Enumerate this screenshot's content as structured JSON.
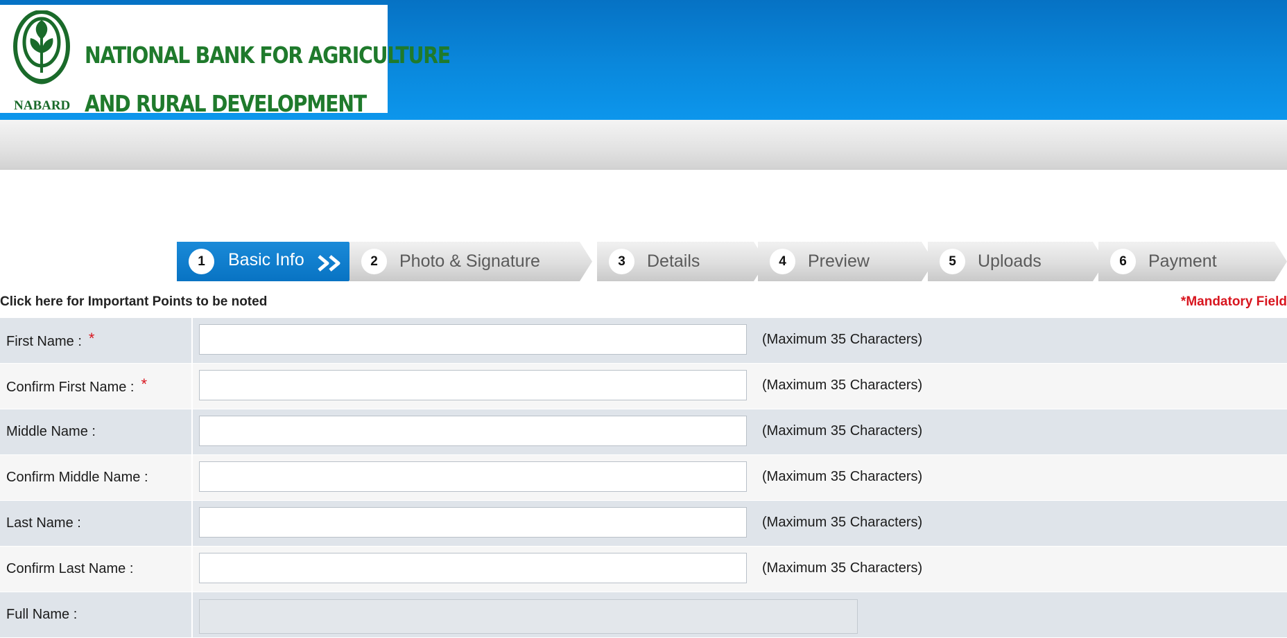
{
  "header": {
    "org_abbr": "NABARD",
    "org_name_line1": "NATIONAL BANK FOR AGRICULTURE",
    "org_name_line2": "AND RURAL DEVELOPMENT",
    "colors": {
      "header_blue": "#0a88dc",
      "logo_green": "#1f7a2c"
    }
  },
  "steps": [
    {
      "num": "1",
      "label": "Basic Info",
      "active": true
    },
    {
      "num": "2",
      "label": "Photo & Signature",
      "active": false
    },
    {
      "num": "3",
      "label": "Details",
      "active": false
    },
    {
      "num": "4",
      "label": "Preview",
      "active": false
    },
    {
      "num": "5",
      "label": "Uploads",
      "active": false
    },
    {
      "num": "6",
      "label": "Payment",
      "active": false
    }
  ],
  "important_link": "Click here for Important Points to be noted",
  "mandatory_note": "*Mandatory Field",
  "form": {
    "fields": [
      {
        "label": "First Name :",
        "required": "*",
        "value": "",
        "hint": "(Maximum 35 Characters)"
      },
      {
        "label": "Confirm First Name :",
        "required": "*",
        "value": "",
        "hint": "(Maximum 35 Characters)"
      },
      {
        "label": "Middle Name :",
        "required": "",
        "value": "",
        "hint": "(Maximum 35 Characters)"
      },
      {
        "label": "Confirm Middle Name :",
        "required": "",
        "value": "",
        "hint": "(Maximum 35 Characters)"
      },
      {
        "label": "Last Name :",
        "required": "",
        "value": "",
        "hint": "(Maximum 35 Characters)"
      },
      {
        "label": "Confirm Last Name :",
        "required": "",
        "value": "",
        "hint": "(Maximum 35 Characters)"
      },
      {
        "label": "Full Name :",
        "required": "",
        "value": "",
        "hint": ""
      }
    ]
  }
}
